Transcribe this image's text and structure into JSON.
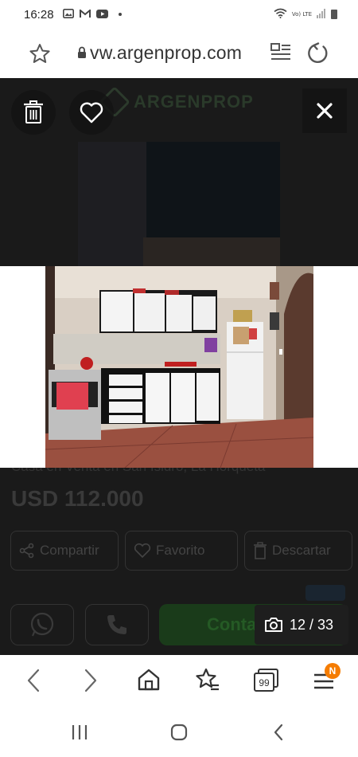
{
  "status_bar": {
    "time": "16:28",
    "notification_icons": [
      "gallery-icon",
      "gmail-icon",
      "youtube-icon"
    ],
    "network": "Vo) LTE"
  },
  "url_bar": {
    "url": "vw.argenprop.com"
  },
  "background_page": {
    "logo_text": "ARGENPROP",
    "listing_title": "Casa en Venta en San Isidro, La Horqueta",
    "price": "USD 112.000",
    "actions": [
      "Compartir",
      "Favorito",
      "Descartar"
    ],
    "contact_label": "Contactar"
  },
  "gallery": {
    "counter": "12 / 33",
    "current_index": 12,
    "total": 33,
    "close_icon": "close-icon",
    "photo_subject": "kitchen"
  },
  "toolbar": {
    "tabs_count": "99",
    "menu_badge": "N"
  },
  "colors": {
    "badge_orange": "#f57c00",
    "overlay": "#141414"
  }
}
